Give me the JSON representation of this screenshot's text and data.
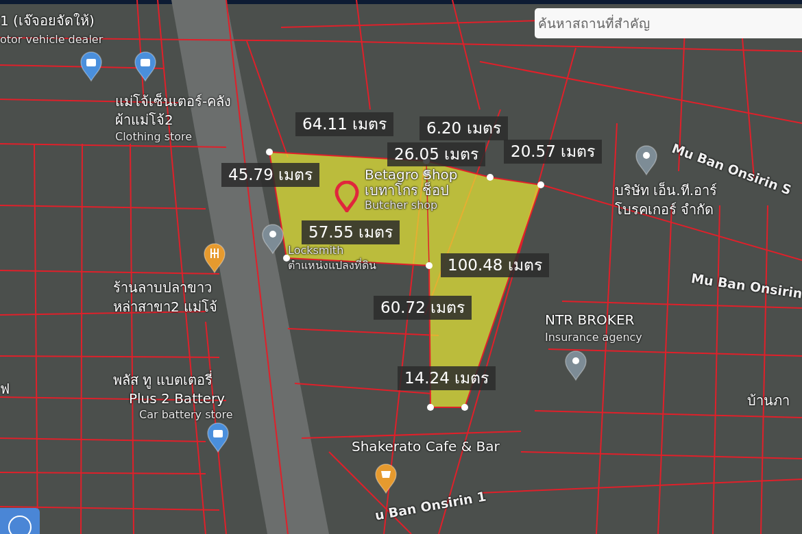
{
  "search": {
    "placeholder": "ค้นหาสถานที่สำคัญ"
  },
  "measurements": [
    {
      "text": "64.11 เมตร"
    },
    {
      "text": "6.20 เมตร"
    },
    {
      "text": "26.05 เมตร"
    },
    {
      "text": "20.57 เมตร"
    },
    {
      "text": "45.79 เมตร"
    },
    {
      "text": "57.55 เมตร"
    },
    {
      "text": "100.48 เมตร"
    },
    {
      "text": "60.72 เมตร"
    },
    {
      "text": "14.24 เมตร"
    }
  ],
  "map_labels": [
    {
      "text": "1 (เจ๊จอยจัดให้)",
      "kind": "title"
    },
    {
      "text": "otor vehicle dealer",
      "kind": "category"
    },
    {
      "text": "แม่โจ้เซ็นเตอร์-คลัง",
      "kind": "title"
    },
    {
      "text": "ผ้าแม่โจ้2",
      "kind": "title"
    },
    {
      "text": "Clothing store",
      "kind": "category"
    },
    {
      "text": "Betagro Shop",
      "kind": "title"
    },
    {
      "text": "เบทาโกร ช็อป",
      "kind": "title"
    },
    {
      "text": "Butcher shop",
      "kind": "category"
    },
    {
      "text": "Locksmith",
      "kind": "category"
    },
    {
      "text": "ตำแหน่งแปลงที่ดิน",
      "kind": "category"
    },
    {
      "text": "ร้านลาบปลาขาว",
      "kind": "title"
    },
    {
      "text": "หล่าสาขา2 แม่โจ้",
      "kind": "title"
    },
    {
      "text": "พลัส ทู แบตเตอรี่",
      "kind": "title"
    },
    {
      "text": "Plus 2 Battery",
      "kind": "title"
    },
    {
      "text": "Car battery store",
      "kind": "category"
    },
    {
      "text": "Shakerato Cafe & Bar",
      "kind": "title"
    },
    {
      "text": "NTR BROKER",
      "kind": "title"
    },
    {
      "text": "Insurance agency",
      "kind": "category"
    },
    {
      "text": "บริษัท เอ็น.ที.อาร์",
      "kind": "title"
    },
    {
      "text": "โบรคเกอร์ จำกัด",
      "kind": "title"
    },
    {
      "text": "Mu Ban Onsirin S",
      "kind": "road"
    },
    {
      "text": "Mu Ban Onsirin",
      "kind": "road"
    },
    {
      "text": "บ้านภา",
      "kind": "title"
    },
    {
      "text": "u Ban Onsirin 1",
      "kind": "road"
    },
    {
      "text": "ฟ",
      "kind": "title"
    }
  ],
  "pins": [
    {
      "kind": "shopping"
    },
    {
      "kind": "shopping"
    },
    {
      "kind": "place"
    },
    {
      "kind": "food"
    },
    {
      "kind": "location"
    },
    {
      "kind": "place"
    },
    {
      "kind": "place"
    },
    {
      "kind": "shopping"
    },
    {
      "kind": "cafe"
    }
  ]
}
